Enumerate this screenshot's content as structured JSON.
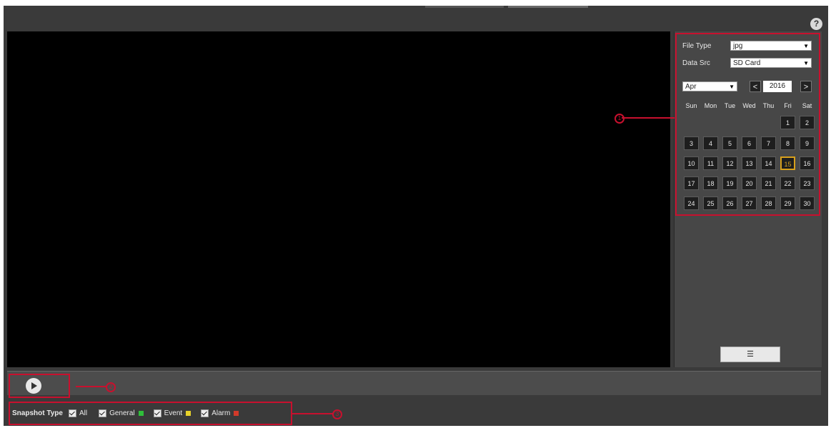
{
  "header": {
    "help_label": "?"
  },
  "search_panel": {
    "file_type": {
      "label": "File Type",
      "value": "jpg"
    },
    "data_src": {
      "label": "Data Src",
      "value": "SD Card"
    },
    "month": "Apr",
    "year": "2016",
    "prev_label": "<",
    "next_label": ">",
    "weekdays": [
      "Sun",
      "Mon",
      "Tue",
      "Wed",
      "Thu",
      "Fri",
      "Sat"
    ],
    "days": [
      "1",
      "2",
      "3",
      "4",
      "5",
      "6",
      "7",
      "8",
      "9",
      "10",
      "11",
      "12",
      "13",
      "14",
      "15",
      "16",
      "17",
      "18",
      "19",
      "20",
      "21",
      "22",
      "23",
      "24",
      "25",
      "26",
      "27",
      "28",
      "29",
      "30"
    ],
    "today": "15",
    "list_button_label": "☰"
  },
  "controls": {
    "play_label": ""
  },
  "snapshot_legend": {
    "label": "Snapshot Type",
    "items": [
      {
        "name": "All",
        "color": ""
      },
      {
        "name": "General",
        "color": "#2fbf3a"
      },
      {
        "name": "Event",
        "color": "#e8d22a"
      },
      {
        "name": "Alarm",
        "color": "#d23a2a"
      }
    ]
  },
  "annotations": {
    "one": "1",
    "two": "2",
    "three": "3"
  }
}
